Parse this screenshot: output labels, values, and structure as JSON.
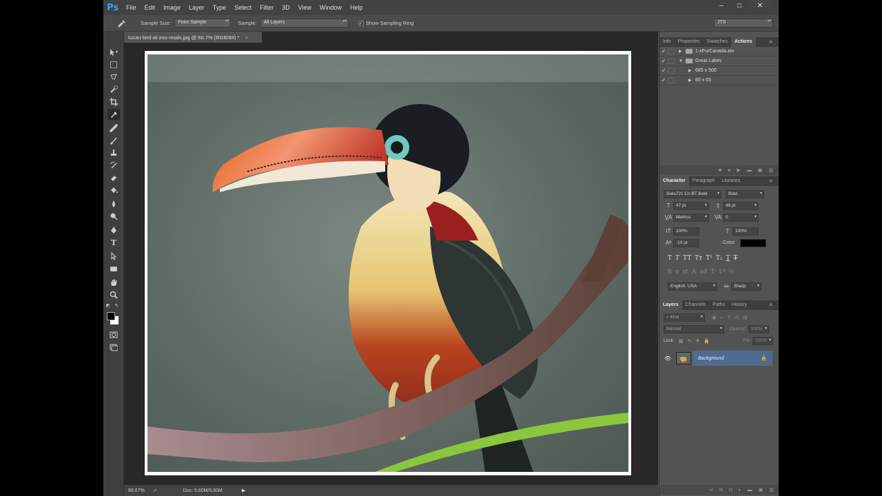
{
  "app": {
    "logo": "Ps"
  },
  "menu": [
    "File",
    "Edit",
    "Image",
    "Layer",
    "Type",
    "Select",
    "Filter",
    "3D",
    "View",
    "Window",
    "Help"
  ],
  "window_buttons": {
    "minimize": "–",
    "restore": "□",
    "close": "✕"
  },
  "options": {
    "sample_size_label": "Sample Size:",
    "sample_size_value": "Point Sample",
    "sample_label": "Sample:",
    "sample_value": "All Layers",
    "show_ring_label": "Show Sampling Ring",
    "workspace": "JTS"
  },
  "document": {
    "tab_title": "tucan-bird-at-zoo-mods.jpg @ 66.7% (RGB/8#) *",
    "tab_close": "×",
    "zoom": "66.67%",
    "doc_size": "Doc: 5.60M/5.60M"
  },
  "panels": {
    "top_tabs": [
      "Info",
      "Properties",
      "Swatches",
      "Actions"
    ],
    "actions": [
      {
        "name": "1-xFurCanada.atn",
        "expanded": false,
        "folder": true
      },
      {
        "name": "Great Lakes",
        "expanded": true,
        "folder": true
      },
      {
        "name": "665 x 500",
        "expanded": false,
        "folder": false
      },
      {
        "name": "85 x 65",
        "expanded": false,
        "folder": false
      }
    ],
    "char_tabs": [
      "Character",
      "Paragraph",
      "Libraries"
    ],
    "character": {
      "font_family": "Swis721 Cn BT Bold",
      "font_style": "Bold",
      "size": "47 pt",
      "leading": "46 pt",
      "kerning": "Metrics",
      "tracking": "0",
      "vscale": "100%",
      "hscale": "100%",
      "baseline": "-10 pt",
      "color_label": "Color:",
      "color": "#000000",
      "language": "English: USA",
      "antialias": "Sharp"
    },
    "layers_tabs": [
      "Layers",
      "Channels",
      "Paths",
      "History"
    ],
    "layers": {
      "filter_kind": "Kind",
      "blend_mode": "Normal",
      "opacity_label": "Opacity:",
      "opacity": "100%",
      "lock_label": "Lock:",
      "fill_label": "Fill:",
      "fill": "100%",
      "items": [
        {
          "name": "Background"
        }
      ]
    }
  }
}
